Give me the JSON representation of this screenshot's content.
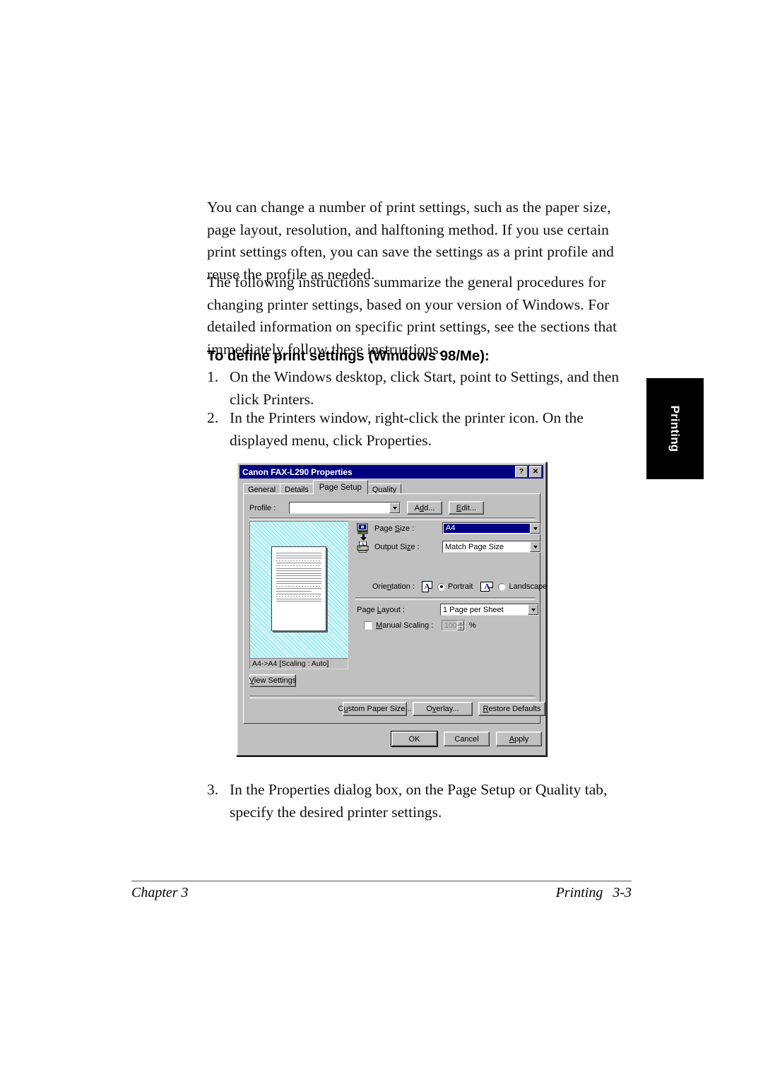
{
  "document": {
    "paragraphs": [
      "You can change a number of print settings, such as the paper size, page layout, resolution, and halftoning method. If you use certain print settings often, you can save the settings as a print profile and reuse the profile as needed.",
      "The following instructions summarize the general procedures for changing printer settings, based on your version of Windows. For detailed information on specific print settings, see the sections that immediately follow these instructions."
    ],
    "heading": "To define print settings (Windows 98/Me):",
    "steps": [
      {
        "num": "1.",
        "text": "On the Windows desktop, click Start, point to Settings, and then click Printers."
      },
      {
        "num": "2.",
        "text": "In the Printers window, right-click the printer icon. On the displayed menu, click Properties."
      },
      {
        "num": "3.",
        "text": "In the Properties dialog box, on the Page Setup or Quality tab, specify the desired printer settings."
      }
    ],
    "side_tab": "Printing",
    "footer": {
      "left": "Chapter 3",
      "right_section": "Printing",
      "page_number": "3-3"
    }
  },
  "dialog": {
    "title": "Canon FAX-L290 Properties",
    "title_buttons": {
      "help": "?",
      "close": "✕"
    },
    "tabs": [
      {
        "label": "General",
        "active": false
      },
      {
        "label": "Details",
        "active": false
      },
      {
        "label": "Page Setup",
        "active": true
      },
      {
        "label": "Quality",
        "active": false
      }
    ],
    "profile": {
      "label": "Profile :",
      "value": "",
      "add_button": "Add...",
      "edit_button": "Edit..."
    },
    "preview": {
      "status": "A4->A4 [Scaling : Auto]",
      "view_settings_button": "View Settings"
    },
    "page_size": {
      "label": "Page Size :",
      "value": "A4"
    },
    "output_size": {
      "label": "Output Size :",
      "value": "Match Page Size"
    },
    "orientation": {
      "label": "Orientation :",
      "portrait": "Portrait",
      "landscape": "Landscape",
      "selected": "Portrait",
      "icon_glyph": "A"
    },
    "page_layout": {
      "label": "Page Layout :",
      "value": "1 Page per Sheet"
    },
    "manual_scaling": {
      "label": "Manual Scaling :",
      "checked": false,
      "value": "100",
      "unit": "%"
    },
    "action_buttons": {
      "custom_paper_size": "Custom Paper Size...",
      "overlay": "Overlay...",
      "restore_defaults": "Restore Defaults"
    },
    "footer_buttons": {
      "ok": "OK",
      "cancel": "Cancel",
      "apply": "Apply"
    }
  },
  "colors": {
    "title_bar": "#000080",
    "dialog_face": "#c0c0c0",
    "preview_hatch": "#5ee4f2",
    "selected_highlight": "#000080",
    "side_tab": "#000000"
  }
}
